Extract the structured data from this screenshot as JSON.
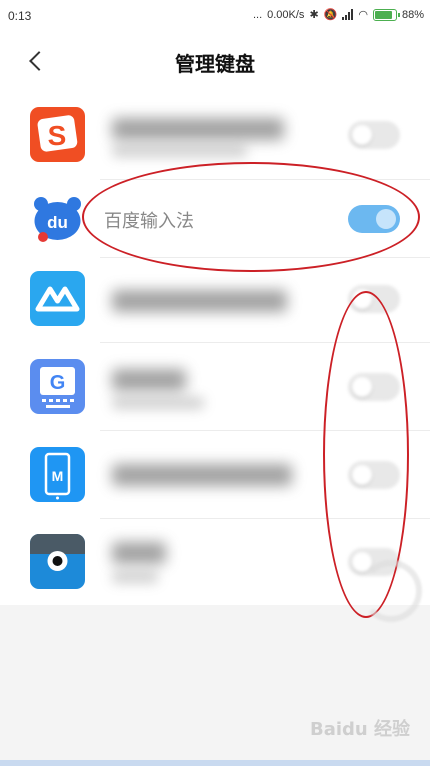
{
  "status": {
    "time": "0:13",
    "dots": "...",
    "speed": "0.00K/s",
    "battery": "88%"
  },
  "header": {
    "title": "管理键盘"
  },
  "keyboards": [
    {
      "id": "sogou",
      "name": "",
      "enabled": false
    },
    {
      "id": "baidu",
      "name": "百度输入法",
      "enabled": true
    },
    {
      "id": "xunfei",
      "name": "",
      "enabled": false
    },
    {
      "id": "gboard",
      "name": "",
      "enabled": false
    },
    {
      "id": "micro",
      "name": "",
      "enabled": false
    },
    {
      "id": "other",
      "name": "",
      "enabled": false
    }
  ],
  "icons": {
    "sogou": {
      "letter": "S",
      "bg": "#f04e23"
    },
    "baidu": {
      "letter": "du",
      "bg": "#2f78e0"
    },
    "xunfei": {
      "bg": "#2aa7ef"
    },
    "gboard": {
      "letter": "G",
      "bg": "#5b8def"
    },
    "micro": {
      "letter": "M",
      "bg": "#1f96f3"
    },
    "other": {
      "bg": "#1d8ad9"
    }
  },
  "watermark": "Baidu 经验"
}
